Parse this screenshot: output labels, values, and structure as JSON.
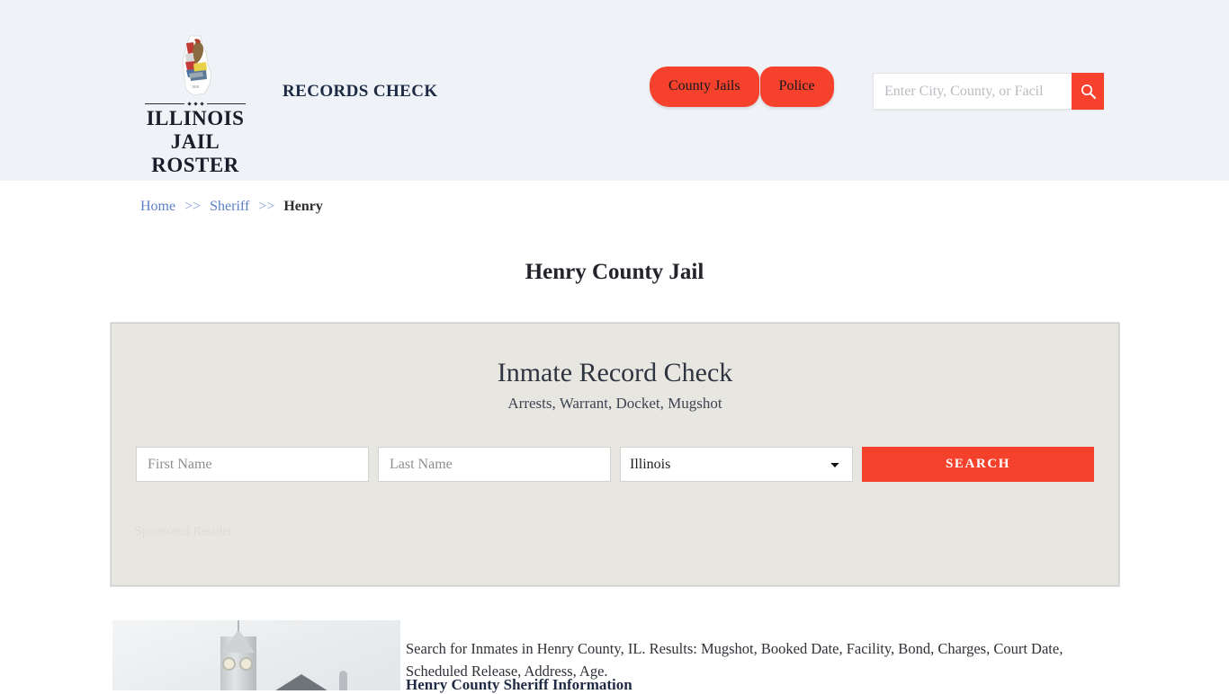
{
  "header": {
    "logo": {
      "icon": "illinois-state-outline-seal",
      "line1": "ILLINOIS",
      "line2": "JAIL ROSTER"
    },
    "tagline": "RECORDS CHECK",
    "nav": [
      {
        "label": "County Jails"
      },
      {
        "label": "Police"
      }
    ],
    "search": {
      "placeholder": "Enter City, County, or Facil",
      "value": "",
      "icon": "search-icon"
    },
    "background_color": "#eff3f8",
    "accent_color": "#f6412d"
  },
  "breadcrumb": {
    "items": [
      {
        "label": "Home",
        "link": true
      },
      {
        "label": "Sheriff",
        "link": true
      },
      {
        "label": "Henry",
        "link": false
      }
    ],
    "separator": ">>"
  },
  "page_title": "Henry County Jail",
  "record_panel": {
    "title": "Inmate Record Check",
    "subtitle": "Arrests, Warrant, Docket, Mugshot",
    "first_name_placeholder": "First Name",
    "first_name_value": "",
    "last_name_placeholder": "Last Name",
    "last_name_value": "",
    "state_selected": "Illinois",
    "state_options": [
      "Illinois"
    ],
    "search_button": "SEARCH",
    "sponsored_label": "Sponsored Results",
    "background_color": "#e8e6e1",
    "button_color": "#f4412c"
  },
  "content": {
    "photo_alt": "henry-county-courthouse-photo",
    "paragraph": "Search for Inmates in Henry County, IL. Results: Mugshot, Booked Date, Facility, Bond, Charges, Court Date, Scheduled Release, Address, Age.",
    "section_heading": "Henry County Sheriff Information"
  }
}
